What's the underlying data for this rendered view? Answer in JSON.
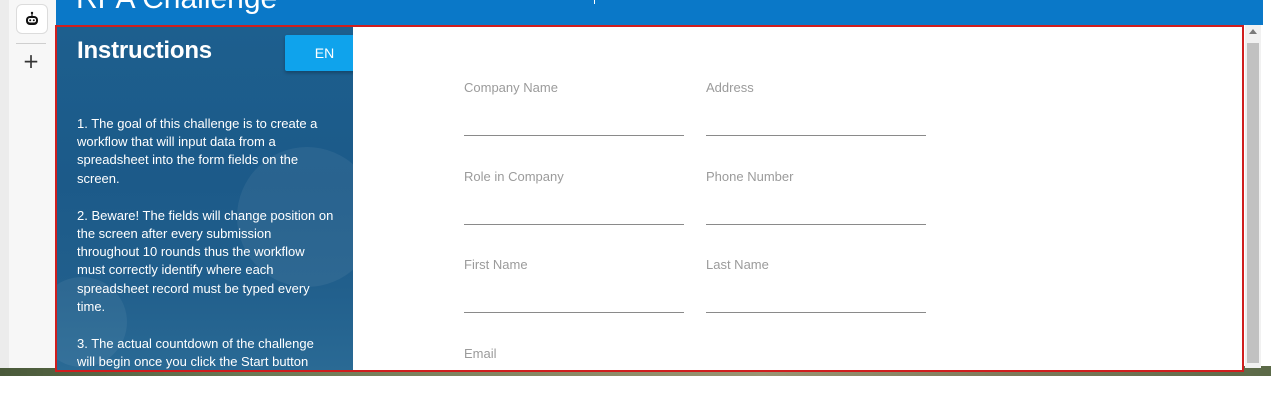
{
  "header": {
    "title": "RPA Challenge"
  },
  "sidebar": {
    "add_label": "+"
  },
  "instructions": {
    "heading": "Instructions",
    "language_button": "EN",
    "steps": [
      "1. The goal of this challenge is to create a workflow that will input data from a spreadsheet into the form fields on the screen.",
      "2. Beware! The fields will change position on the screen after every submission throughout 10 rounds thus the workflow must correctly identify where each spreadsheet record must be typed every time.",
      "3. The actual countdown of the challenge will begin once you click the Start button"
    ]
  },
  "form": {
    "fields": [
      {
        "label": "Company Name",
        "value": ""
      },
      {
        "label": "Address",
        "value": ""
      },
      {
        "label": "Role in Company",
        "value": ""
      },
      {
        "label": "Phone Number",
        "value": ""
      },
      {
        "label": "First Name",
        "value": ""
      },
      {
        "label": "Last Name",
        "value": ""
      },
      {
        "label": "Email",
        "value": ""
      }
    ]
  },
  "colors": {
    "header": "#0a78c8",
    "panel": "#1d5f8e",
    "button": "#0fa3ec",
    "frame_border": "#d01e1e"
  },
  "icons": {
    "extension": "robot-icon",
    "add": "plus-icon"
  }
}
